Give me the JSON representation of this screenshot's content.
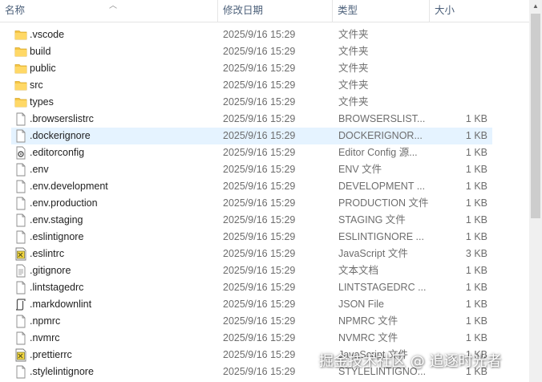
{
  "columns": {
    "name": "名称",
    "date": "修改日期",
    "type": "类型",
    "size": "大小"
  },
  "files": [
    {
      "name": ".vscode",
      "date": "2025/9/16 15:29",
      "type": "文件夹",
      "size": "",
      "icon": "folder-icon"
    },
    {
      "name": "build",
      "date": "2025/9/16 15:29",
      "type": "文件夹",
      "size": "",
      "icon": "folder-icon"
    },
    {
      "name": "public",
      "date": "2025/9/16 15:29",
      "type": "文件夹",
      "size": "",
      "icon": "folder-icon"
    },
    {
      "name": "src",
      "date": "2025/9/16 15:29",
      "type": "文件夹",
      "size": "",
      "icon": "folder-icon"
    },
    {
      "name": "types",
      "date": "2025/9/16 15:29",
      "type": "文件夹",
      "size": "",
      "icon": "folder-icon"
    },
    {
      "name": ".browserslistrc",
      "date": "2025/9/16 15:29",
      "type": "BROWSERSLIST...",
      "size": "1 KB",
      "icon": "file-icon"
    },
    {
      "name": ".dockerignore",
      "date": "2025/9/16 15:29",
      "type": "DOCKERIGNOR...",
      "size": "1 KB",
      "icon": "file-icon",
      "selected": true
    },
    {
      "name": ".editorconfig",
      "date": "2025/9/16 15:29",
      "type": "Editor Config 源...",
      "size": "1 KB",
      "icon": "config-file-icon"
    },
    {
      "name": ".env",
      "date": "2025/9/16 15:29",
      "type": "ENV 文件",
      "size": "1 KB",
      "icon": "file-icon"
    },
    {
      "name": ".env.development",
      "date": "2025/9/16 15:29",
      "type": "DEVELOPMENT ...",
      "size": "1 KB",
      "icon": "file-icon"
    },
    {
      "name": ".env.production",
      "date": "2025/9/16 15:29",
      "type": "PRODUCTION 文件",
      "size": "1 KB",
      "icon": "file-icon"
    },
    {
      "name": ".env.staging",
      "date": "2025/9/16 15:29",
      "type": "STAGING 文件",
      "size": "1 KB",
      "icon": "file-icon"
    },
    {
      "name": ".eslintignore",
      "date": "2025/9/16 15:29",
      "type": "ESLINTIGNORE ...",
      "size": "1 KB",
      "icon": "file-icon"
    },
    {
      "name": ".eslintrc",
      "date": "2025/9/16 15:29",
      "type": "JavaScript 文件",
      "size": "3 KB",
      "icon": "js-file-icon"
    },
    {
      "name": ".gitignore",
      "date": "2025/9/16 15:29",
      "type": "文本文档",
      "size": "1 KB",
      "icon": "text-file-icon"
    },
    {
      "name": ".lintstagedrc",
      "date": "2025/9/16 15:29",
      "type": "LINTSTAGEDRC ...",
      "size": "1 KB",
      "icon": "file-icon"
    },
    {
      "name": ".markdownlint",
      "date": "2025/9/16 15:29",
      "type": "JSON File",
      "size": "1 KB",
      "icon": "json-file-icon"
    },
    {
      "name": ".npmrc",
      "date": "2025/9/16 15:29",
      "type": "NPMRC 文件",
      "size": "1 KB",
      "icon": "file-icon"
    },
    {
      "name": ".nvmrc",
      "date": "2025/9/16 15:29",
      "type": "NVMRC 文件",
      "size": "1 KB",
      "icon": "file-icon"
    },
    {
      "name": ".prettierrc",
      "date": "2025/9/16 15:29",
      "type": "JavaScript 文件",
      "size": "1 KB",
      "icon": "js-file-icon"
    },
    {
      "name": ".stylelintignore",
      "date": "2025/9/16 15:29",
      "type": "STYLELINTIGNO...",
      "size": "1 KB",
      "icon": "file-icon"
    }
  ],
  "watermark": "掘金技术社区 @ 追逐时光者",
  "colors": {
    "header_text": "#4c607a",
    "selection": "#e5f3ff",
    "folder": "#f5c544"
  }
}
